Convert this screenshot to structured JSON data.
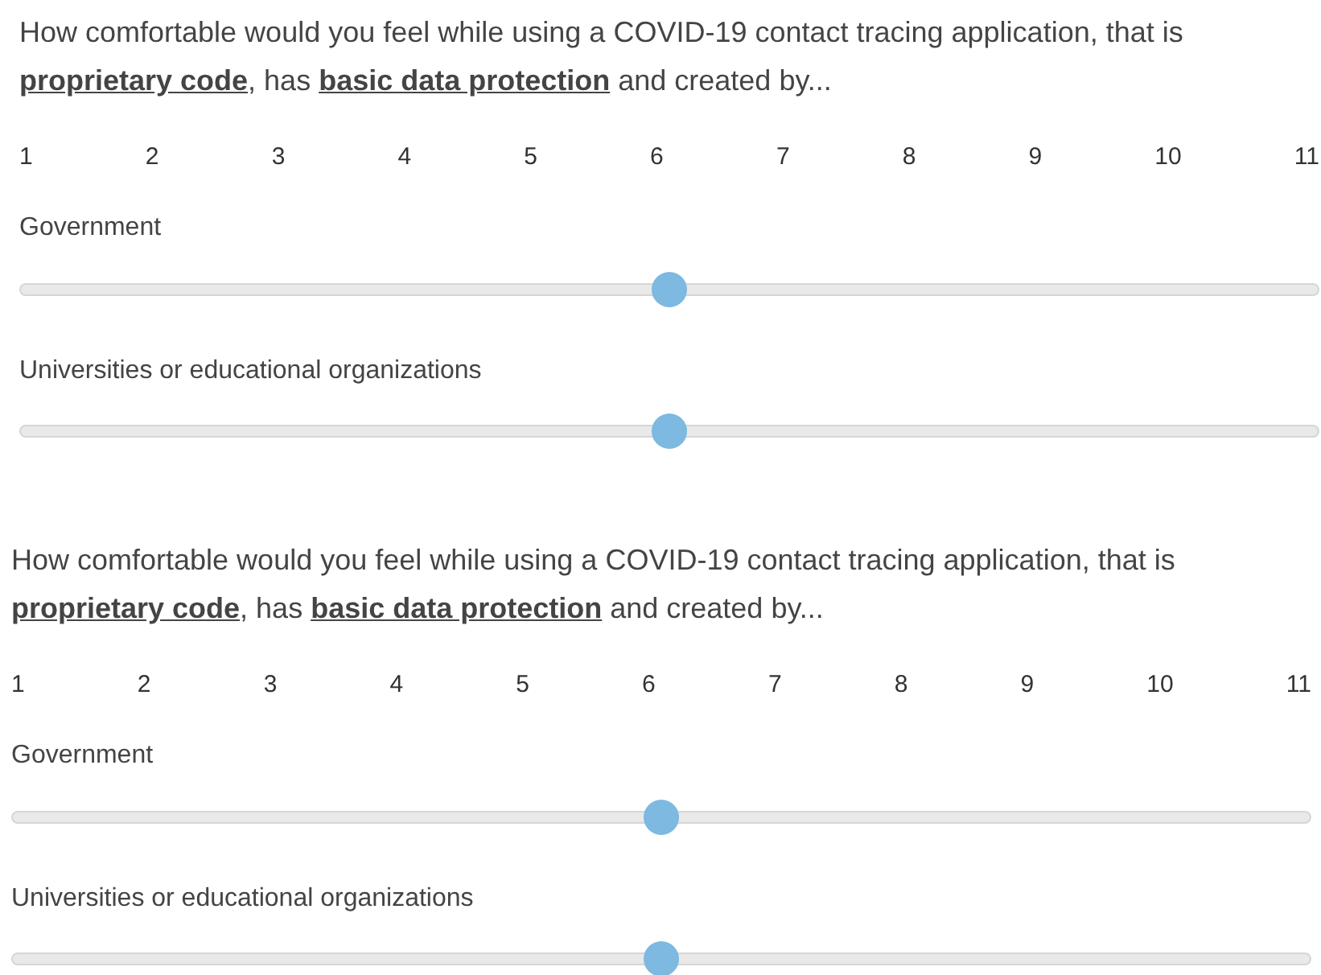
{
  "questions": [
    {
      "prompt": "How comfortable would you feel while using a COVID-19 contact tracing application, that is **proprietary code**, has **basic data protection** and created by...",
      "scale": [
        "1",
        "2",
        "3",
        "4",
        "5",
        "6",
        "7",
        "8",
        "9",
        "10",
        "11"
      ],
      "sliders": [
        {
          "label": "Government",
          "level": 0.5
        },
        {
          "label": "Universities or educational organizations",
          "level": 0.5
        }
      ]
    },
    {
      "prompt": "How comfortable would you feel while using a COVID-19 contact tracing application, that is **proprietary code**, has **basic data protection** and created by...",
      "scale": [
        "1",
        "2",
        "3",
        "4",
        "5",
        "6",
        "7",
        "8",
        "9",
        "10",
        "11"
      ],
      "sliders": [
        {
          "label": "Government",
          "level": 0.5
        },
        {
          "label": "Universities or educational organizations",
          "level": 0.5
        }
      ]
    }
  ]
}
